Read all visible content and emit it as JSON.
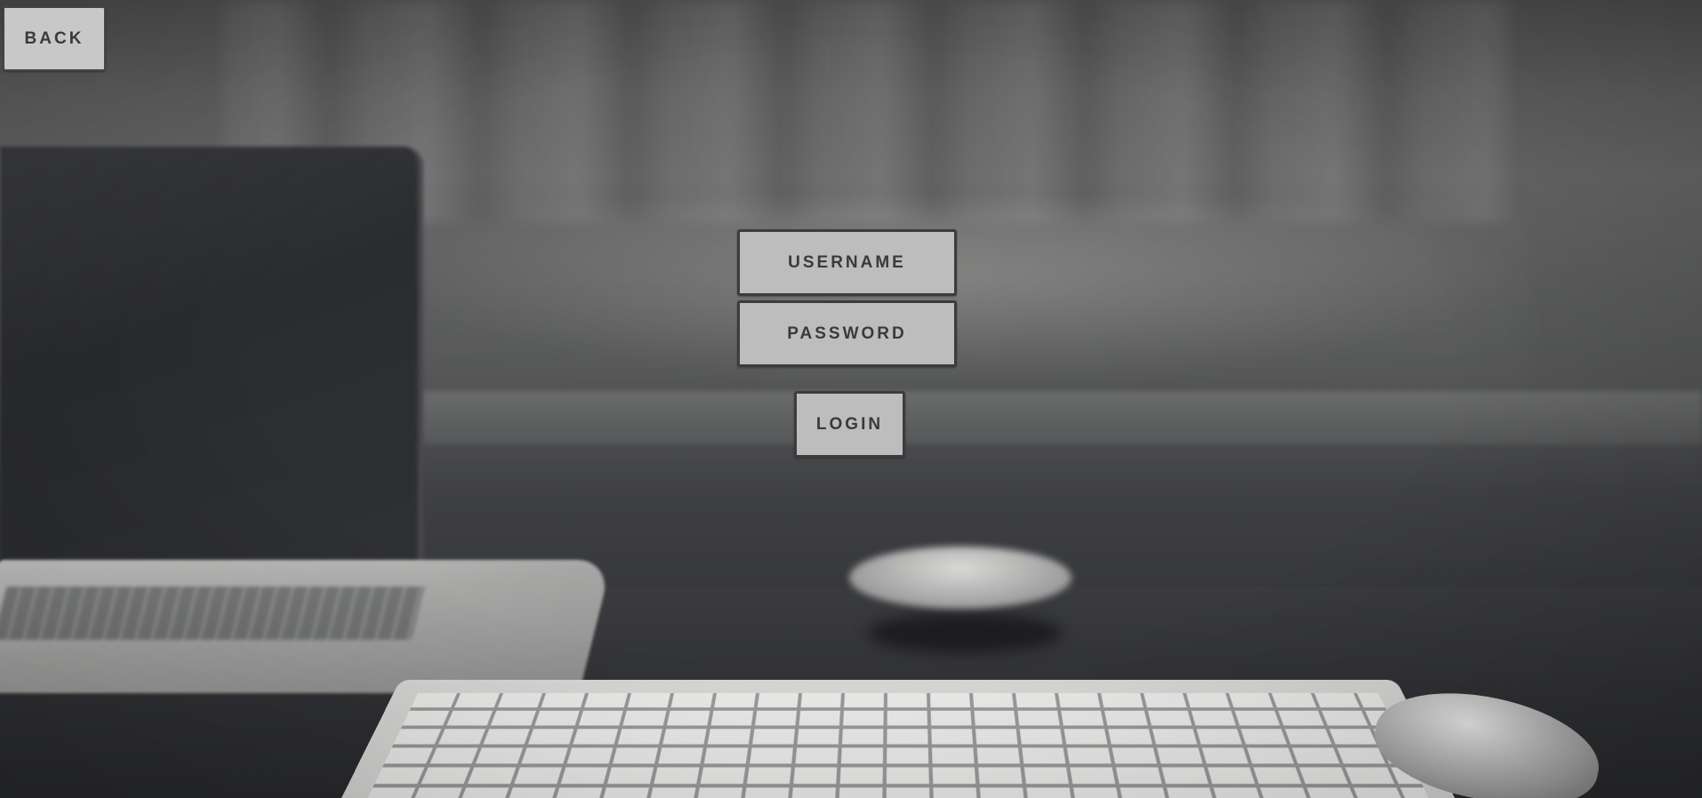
{
  "nav": {
    "back_label": "BACK"
  },
  "login_form": {
    "username_label": "USERNAME",
    "password_label": "PASSWORD",
    "login_label": "LOGIN"
  },
  "colors": {
    "button_fill": "#bdbdbd",
    "button_border": "#3c3c3c",
    "button_text": "#3a3a3a"
  }
}
